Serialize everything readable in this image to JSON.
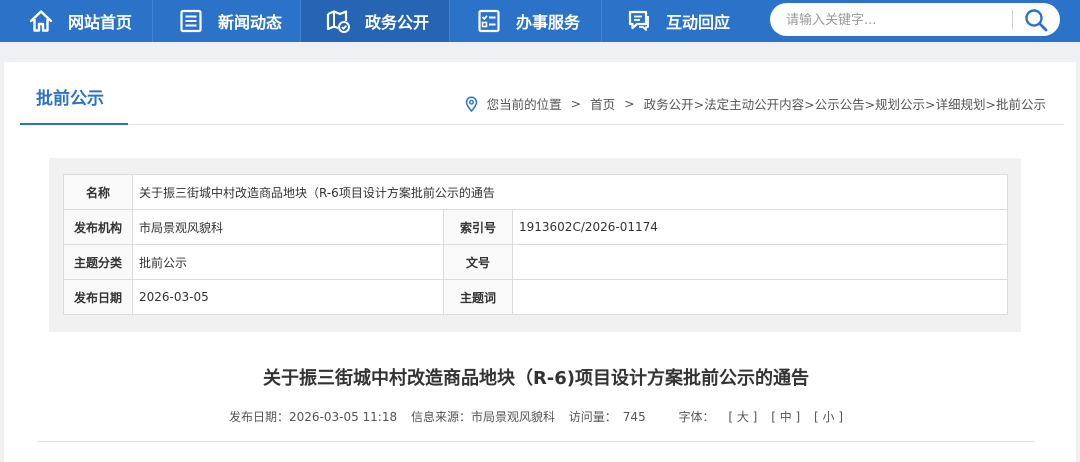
{
  "nav": {
    "items": [
      {
        "label": "网站首页",
        "icon": "home-icon"
      },
      {
        "label": "新闻动态",
        "icon": "newspaper-icon"
      },
      {
        "label": "政务公开",
        "icon": "open-gov-icon"
      },
      {
        "label": "办事服务",
        "icon": "service-checklist-icon"
      },
      {
        "label": "互动回应",
        "icon": "chat-icon"
      }
    ],
    "active_index": 2
  },
  "search": {
    "placeholder": "请输入关键字...",
    "icon": "search-icon"
  },
  "page": {
    "title": "批前公示"
  },
  "breadcrumb": {
    "prefix": "您当前的位置",
    "home": "首页",
    "trail": "政务公开>法定主动公开内容>公示公告>规划公示>详细规划>批前公示"
  },
  "meta": {
    "name_label": "名称",
    "name_value": "关于振三街城中村改造商品地块（R-6项目设计方案批前公示的通告",
    "org_label": "发布机构",
    "org_value": "市局景观风貌科",
    "index_label": "索引号",
    "index_value": "1913602C/2026-01174",
    "topic_label": "主题分类",
    "topic_value": "批前公示",
    "docno_label": "文号",
    "docno_value": "",
    "date_label": "发布日期",
    "date_value": "2026-03-05",
    "keyword_label": "主题词",
    "keyword_value": ""
  },
  "article": {
    "title": "关于振三街城中村改造商品地块（R-6)项目设计方案批前公示的通告",
    "publish": "发布日期：2026-03-05 11:18",
    "source": "信息来源：市局景观风貌科",
    "views_label": "访问量：",
    "views": "745",
    "font_label": "字体：",
    "font_large": "[ 大 ]",
    "font_medium": "[ 中 ]",
    "font_small": "[ 小 ]"
  },
  "colors": {
    "brand": "#2a73c8",
    "nav_active": "#2565b3"
  }
}
